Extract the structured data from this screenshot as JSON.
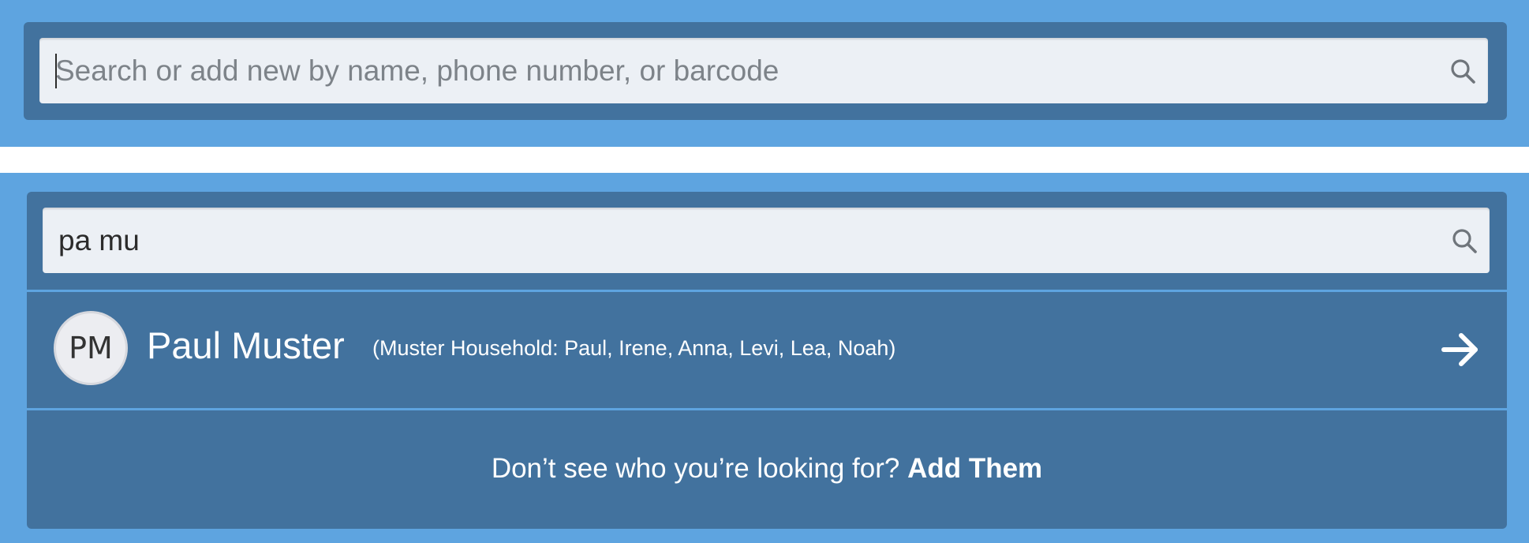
{
  "colors": {
    "panel_bg": "#5ea4e0",
    "card_bg": "#42729e",
    "input_bg": "#ecf0f5"
  },
  "top_search": {
    "placeholder": "Search or add new by name, phone number, or barcode",
    "value": "",
    "icon": "search-icon"
  },
  "bottom_search": {
    "value": "pa mu",
    "icon": "search-icon"
  },
  "results": [
    {
      "initials": "PM",
      "name": "Paul Muster",
      "household": "(Muster Household: Paul, Irene, Anna, Levi, Lea, Noah)",
      "icon": "arrow-right-icon"
    }
  ],
  "footer": {
    "prompt": "Don’t see who you’re looking for?",
    "link": "Add Them"
  }
}
